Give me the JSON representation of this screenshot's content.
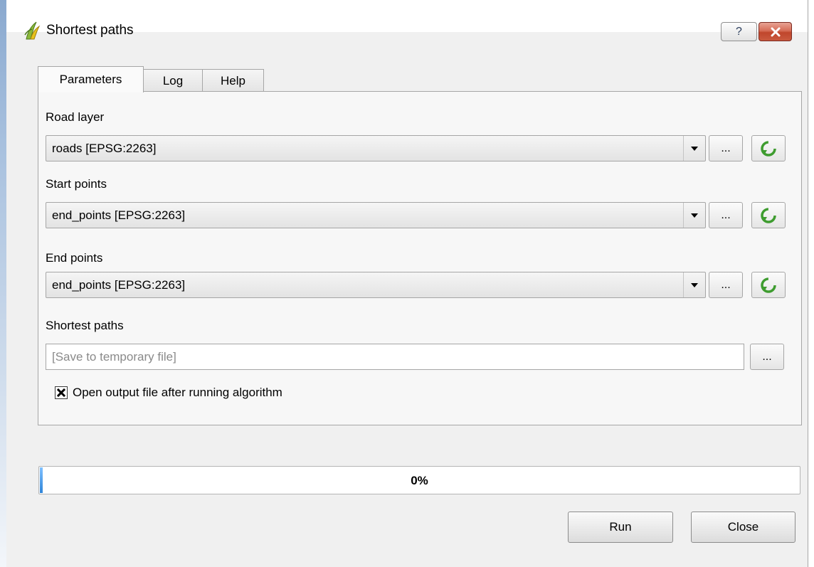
{
  "window": {
    "title": "Shortest paths"
  },
  "tabs": [
    {
      "label": "Parameters",
      "active": true
    },
    {
      "label": "Log",
      "active": false
    },
    {
      "label": "Help",
      "active": false
    }
  ],
  "params": {
    "road_layer": {
      "label": "Road layer",
      "value": "roads [EPSG:2263]"
    },
    "start_points": {
      "label": "Start points",
      "value": "end_points [EPSG:2263]"
    },
    "end_points": {
      "label": "End points",
      "value": "end_points [EPSG:2263]"
    },
    "output": {
      "label": "Shortest paths",
      "placeholder": "[Save to temporary file]"
    },
    "open_output": {
      "label": "Open output file after running algorithm",
      "checked": true
    }
  },
  "browse_label": "...",
  "progress": {
    "value": 0,
    "text": "0%"
  },
  "buttons": {
    "run": "Run",
    "close": "Close"
  },
  "colors": {
    "refresh_icon": "#3e9c2f",
    "progress_fill": "#2e84d8",
    "close_button": "#c0462c"
  }
}
